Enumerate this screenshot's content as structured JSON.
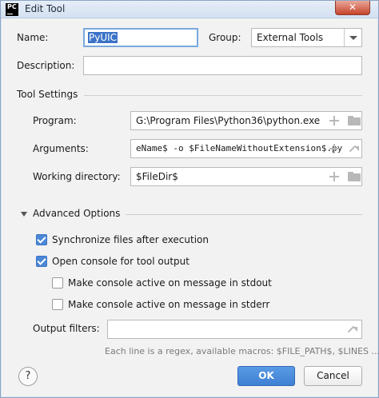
{
  "window": {
    "title": "Edit Tool",
    "app_icon_text": "PC",
    "close_glyph": "✕"
  },
  "name": {
    "label": "Name:",
    "value": "PyUIC"
  },
  "group": {
    "label": "Group:",
    "value": "External Tools"
  },
  "description": {
    "label": "Description:",
    "value": ""
  },
  "tool_settings": {
    "title": "Tool Settings",
    "program": {
      "label": "Program:",
      "value": "G:\\Program Files\\Python36\\python.exe"
    },
    "arguments": {
      "label": "Arguments:",
      "value": "eName$ -o $FileNameWithoutExtension$.py"
    },
    "working_directory": {
      "label": "Working directory:",
      "value": "$FileDir$"
    }
  },
  "advanced": {
    "title": "Advanced Options",
    "sync_files": {
      "label": "Synchronize files after execution",
      "checked": true
    },
    "open_console": {
      "label": "Open console for tool output",
      "checked": true
    },
    "active_stdout": {
      "label": "Make console active on message in stdout",
      "checked": false
    },
    "active_stderr": {
      "label": "Make console active on message in stderr",
      "checked": false
    },
    "output_filters": {
      "label": "Output filters:",
      "value": ""
    },
    "hint": "Each line is a regex, available macros: $FILE_PATH$, $LINES ..."
  },
  "footer": {
    "help_label": "?",
    "ok_label": "OK",
    "cancel_label": "Cancel"
  },
  "colors": {
    "accent": "#3f7fd2",
    "checkbox": "#4a88d6",
    "selection": "#3b73c7"
  }
}
